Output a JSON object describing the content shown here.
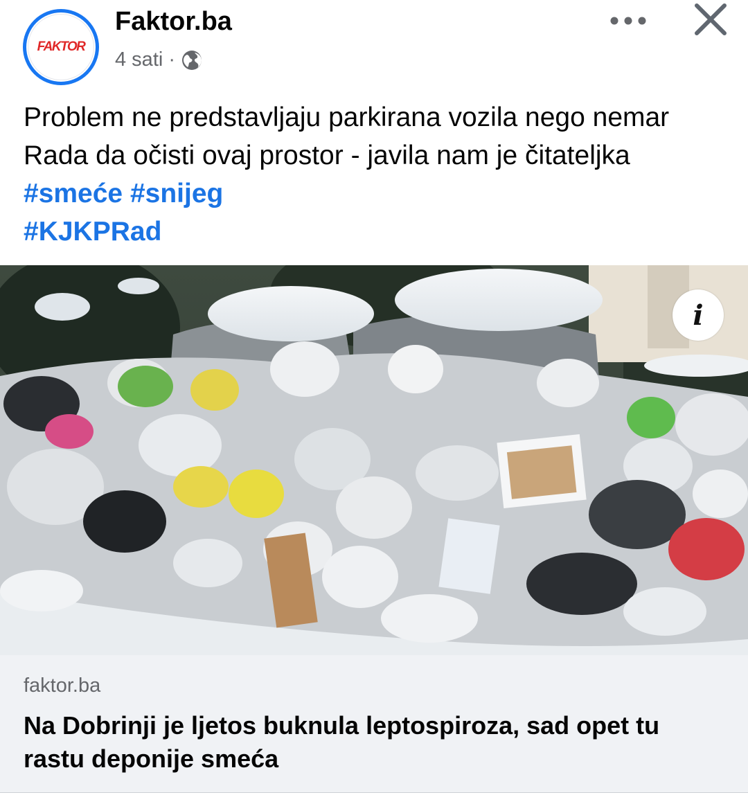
{
  "post": {
    "page_name": "Faktor.ba",
    "logo_text": "FAKTOR",
    "time": "4 sati",
    "separator": "·",
    "privacy_icon": "globe-icon",
    "text": "Problem ne predstavljaju parkirana vozila nego nemar Rada da očisti ovaj prostor - javila nam je čitateljka",
    "hashtags": [
      "#smeće",
      "#snijeg",
      "#KJKPRad"
    ]
  },
  "header_actions": {
    "more_icon": "more-horizontal-icon",
    "close_icon": "close-icon"
  },
  "photo": {
    "description_icon": "info-icon",
    "info_label": "i"
  },
  "link_preview": {
    "domain": "faktor.ba",
    "title": "Na Dobrinji je ljetos buknula leptospiroza, sad opet tu rastu deponije smeća"
  },
  "colors": {
    "accent": "#1877f2",
    "hashtag": "#1b74e4",
    "secondary_text": "#65676b",
    "logo": "#e02828"
  }
}
